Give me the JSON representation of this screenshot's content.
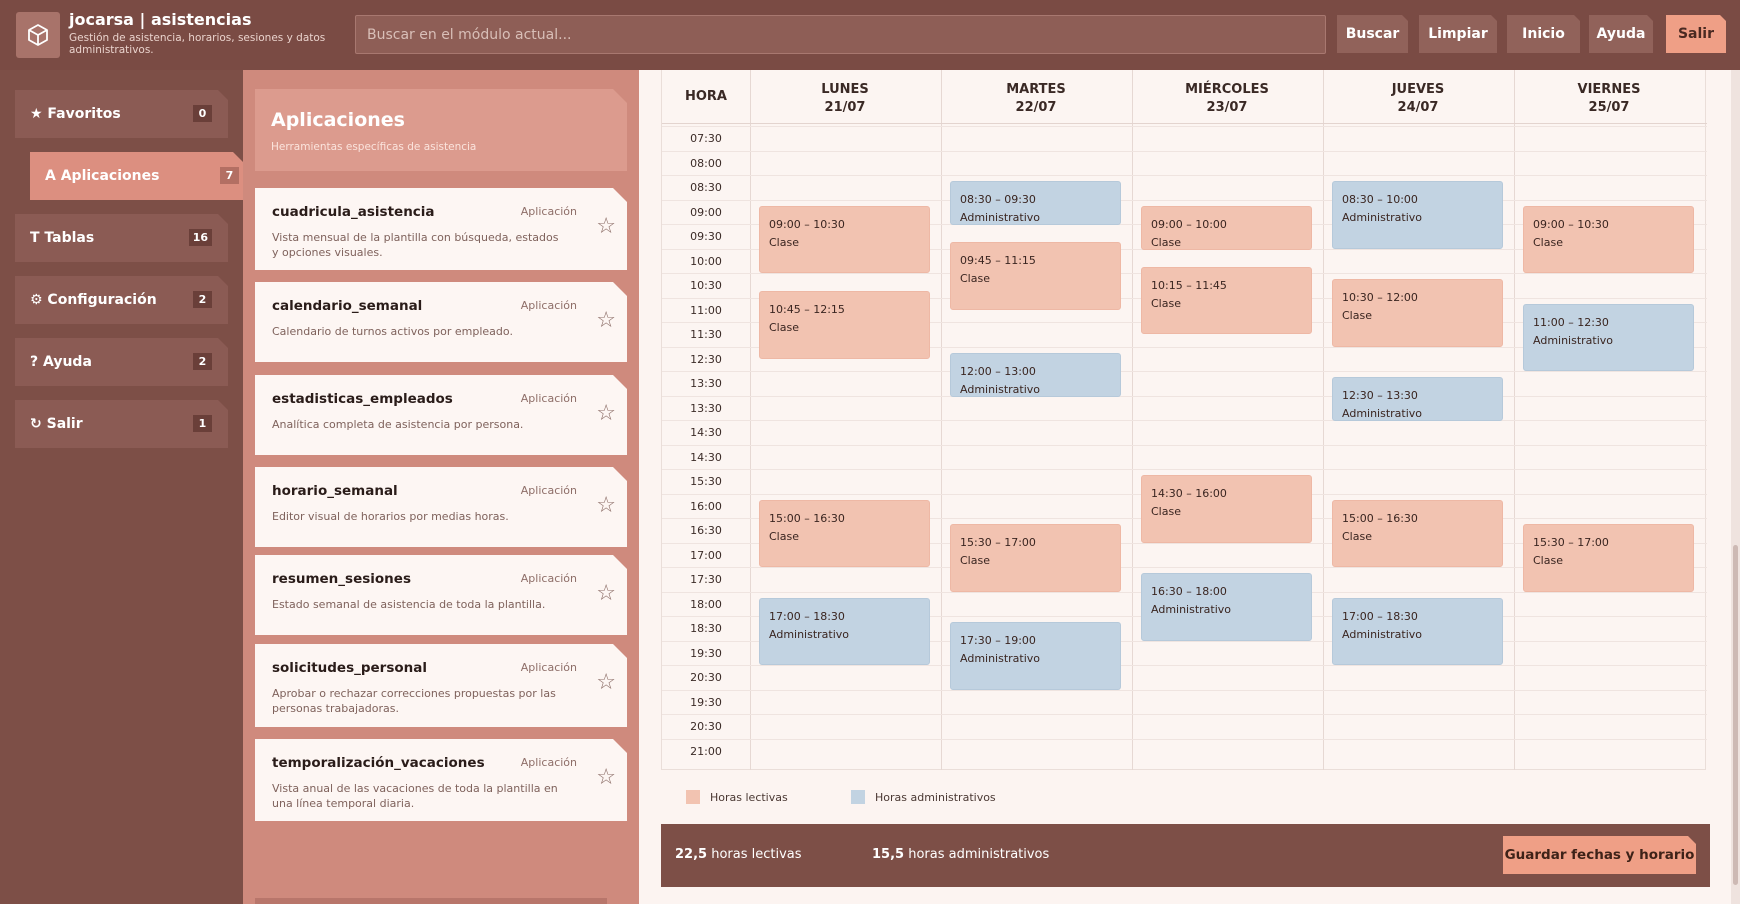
{
  "header": {
    "app_title": "jocarsa | asistencias",
    "app_subtitle": "Gestión de asistencia, horarios, sesiones y datos administrativos.",
    "search_placeholder": "Buscar en el módulo actual...",
    "buttons": [
      "Buscar",
      "Limpiar",
      "Inicio",
      "Ayuda",
      "Salir"
    ]
  },
  "sidebar": {
    "items": [
      {
        "label": "★ Favoritos",
        "count": "0"
      },
      {
        "label": "A Aplicaciones",
        "count": "7"
      },
      {
        "label": "T Tablas",
        "count": "16"
      },
      {
        "label": "⚙ Configuración",
        "count": "2"
      },
      {
        "label": "? Ayuda",
        "count": "2"
      },
      {
        "label": "↻ Salir",
        "count": "1"
      }
    ]
  },
  "apps": {
    "title": "Aplicaciones",
    "subtitle": "Herramientas específicas de asistencia",
    "items": [
      {
        "name": "cuadricula_asistencia",
        "type": "Aplicación",
        "desc": "Vista mensual de la plantilla con búsqueda, estados y opciones visuales."
      },
      {
        "name": "calendario_semanal",
        "type": "Aplicación",
        "desc": "Calendario de turnos activos por empleado."
      },
      {
        "name": "estadisticas_empleados",
        "type": "Aplicación",
        "desc": "Analítica completa de asistencia por persona."
      },
      {
        "name": "horario_semanal",
        "type": "Aplicación",
        "desc": "Editor visual de horarios por medias horas."
      },
      {
        "name": "resumen_sesiones",
        "type": "Aplicación",
        "desc": "Estado semanal de asistencia de toda la plantilla."
      },
      {
        "name": "solicitudes_personal",
        "type": "Aplicación",
        "desc": "Aprobar o rechazar correcciones propuestas por las personas trabajadoras."
      },
      {
        "name": "temporalización_vacaciones",
        "type": "Aplicación",
        "desc": "Vista anual de las vacaciones de toda la plantilla en una línea temporal diaria."
      }
    ]
  },
  "calendar": {
    "hour_header": "HORA",
    "days": [
      {
        "name": "LUNES",
        "date": "21/07"
      },
      {
        "name": "MARTES",
        "date": "22/07"
      },
      {
        "name": "MIÉRCOLES",
        "date": "23/07"
      },
      {
        "name": "JUEVES",
        "date": "24/07"
      },
      {
        "name": "VIERNES",
        "date": "25/07"
      }
    ],
    "times": [
      "07:30",
      "08:00",
      "08:30",
      "09:00",
      "09:30",
      "10:00",
      "10:30",
      "11:00",
      "11:30",
      "12:30",
      "13:30",
      "13:30",
      "14:30",
      "14:30",
      "15:30",
      "16:00",
      "16:30",
      "17:00",
      "17:30",
      "18:00",
      "18:30",
      "19:30",
      "20:30",
      "19:30",
      "20:30",
      "21:00"
    ],
    "events": [
      {
        "day": 0,
        "start": "09:00",
        "end": "10:30",
        "time": "09:00 – 10:30",
        "label": "Clase",
        "kind": "clase"
      },
      {
        "day": 0,
        "start": "10:45",
        "end": "12:15",
        "time": "10:45 – 12:15",
        "label": "Clase",
        "kind": "clase"
      },
      {
        "day": 0,
        "start": "15:00",
        "end": "16:30",
        "time": "15:00 – 16:30",
        "label": "Clase",
        "kind": "clase"
      },
      {
        "day": 0,
        "start": "17:00",
        "end": "18:30",
        "time": "17:00 – 18:30",
        "label": "Administrativo",
        "kind": "adm"
      },
      {
        "day": 1,
        "start": "08:30",
        "end": "09:30",
        "time": "08:30 – 09:30",
        "label": "Administrativo",
        "kind": "adm"
      },
      {
        "day": 1,
        "start": "09:45",
        "end": "11:15",
        "time": "09:45 – 11:15",
        "label": "Clase",
        "kind": "clase"
      },
      {
        "day": 1,
        "start": "12:00",
        "end": "13:00",
        "time": "12:00 – 13:00",
        "label": "Administrativo",
        "kind": "adm"
      },
      {
        "day": 1,
        "start": "15:30",
        "end": "17:00",
        "time": "15:30 – 17:00",
        "label": "Clase",
        "kind": "clase"
      },
      {
        "day": 1,
        "start": "17:30",
        "end": "19:00",
        "time": "17:30 – 19:00",
        "label": "Administrativo",
        "kind": "adm"
      },
      {
        "day": 2,
        "start": "09:00",
        "end": "10:00",
        "time": "09:00 – 10:00",
        "label": "Clase",
        "kind": "clase"
      },
      {
        "day": 2,
        "start": "10:15",
        "end": "11:45",
        "time": "10:15 – 11:45",
        "label": "Clase",
        "kind": "clase"
      },
      {
        "day": 2,
        "start": "14:30",
        "end": "16:00",
        "time": "14:30 – 16:00",
        "label": "Clase",
        "kind": "clase"
      },
      {
        "day": 2,
        "start": "16:30",
        "end": "18:00",
        "time": "16:30 – 18:00",
        "label": "Administrativo",
        "kind": "adm"
      },
      {
        "day": 3,
        "start": "08:30",
        "end": "10:00",
        "time": "08:30 – 10:00",
        "label": "Administrativo",
        "kind": "adm"
      },
      {
        "day": 3,
        "start": "10:30",
        "end": "12:00",
        "time": "10:30 – 12:00",
        "label": "Clase",
        "kind": "clase"
      },
      {
        "day": 3,
        "start": "12:30",
        "end": "13:30",
        "time": "12:30 – 13:30",
        "label": "Administrativo",
        "kind": "adm"
      },
      {
        "day": 3,
        "start": "15:00",
        "end": "16:30",
        "time": "15:00 – 16:30",
        "label": "Clase",
        "kind": "clase"
      },
      {
        "day": 3,
        "start": "17:00",
        "end": "18:30",
        "time": "17:00 – 18:30",
        "label": "Administrativo",
        "kind": "adm"
      },
      {
        "day": 4,
        "start": "09:00",
        "end": "10:30",
        "time": "09:00 – 10:30",
        "label": "Clase",
        "kind": "clase"
      },
      {
        "day": 4,
        "start": "11:00",
        "end": "12:30",
        "time": "11:00 – 12:30",
        "label": "Administrativo",
        "kind": "adm"
      },
      {
        "day": 4,
        "start": "15:30",
        "end": "17:00",
        "time": "15:30 – 17:00",
        "label": "Clase",
        "kind": "clase"
      }
    ]
  },
  "legend": {
    "lectivas": "Horas lectivas",
    "administrativas": "Horas administrativos"
  },
  "footer": {
    "lectivas_value": "22,5",
    "lectivas_label": "horas lectivas",
    "admin_value": "15,5",
    "admin_label": "horas administrativos",
    "save_label": "Guardar fechas y horario"
  },
  "colors": {
    "clase": "#f2c3b1",
    "administrativo": "#c2d3e2",
    "accent": "#ef9f86"
  }
}
